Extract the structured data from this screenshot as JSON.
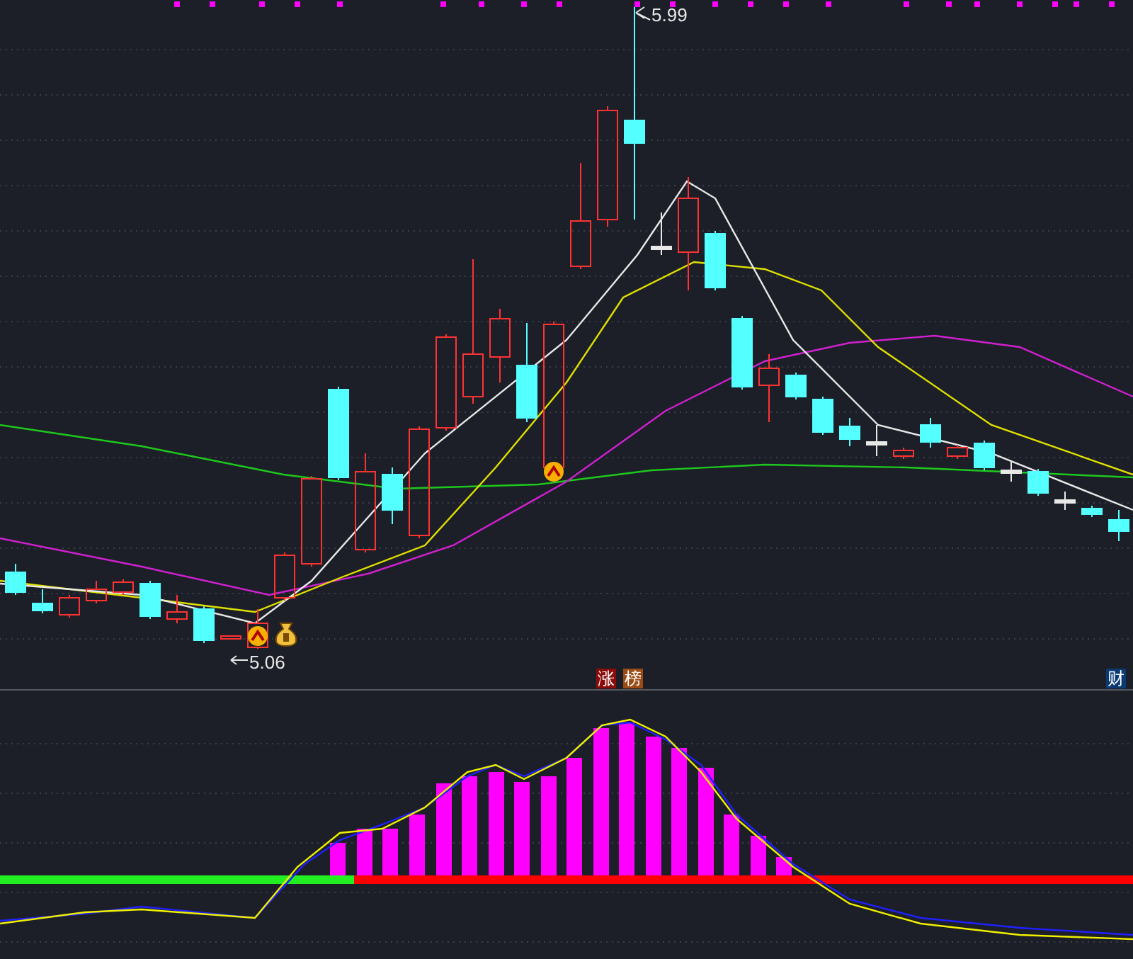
{
  "price_chart": {
    "high_label": "5.99",
    "low_label": "5.06"
  },
  "badges": [
    {
      "text": "涨",
      "color": "#8b0a0a"
    },
    {
      "text": "榜",
      "color": "#9a4a12"
    },
    {
      "text": "财",
      "color": "#0b3a73"
    }
  ]
}
